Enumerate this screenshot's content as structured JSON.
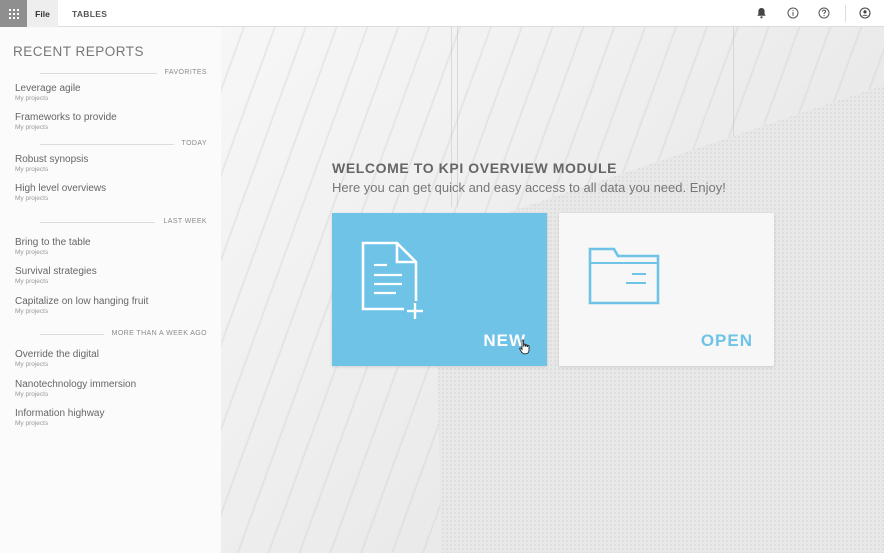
{
  "topbar": {
    "file_tab": "File",
    "tables_tab": "TABLES",
    "icons": [
      "apps-grid-icon",
      "bell-icon",
      "info-icon",
      "help-icon",
      "user-icon"
    ]
  },
  "sidebar": {
    "title": "RECENT REPORTS",
    "sections": [
      {
        "label": "FAVORITES",
        "items": [
          {
            "title": "Leverage agile",
            "subtitle": "My projects"
          },
          {
            "title": "Frameworks to provide",
            "subtitle": "My projects"
          }
        ]
      },
      {
        "label": "TODAY",
        "items": [
          {
            "title": "Robust synopsis",
            "subtitle": "My projects"
          },
          {
            "title": "High level overviews",
            "subtitle": "My projects"
          }
        ]
      },
      {
        "label": "LAST WEEK",
        "items": [
          {
            "title": "Bring to the table",
            "subtitle": "My projects"
          },
          {
            "title": "Survival strategies",
            "subtitle": "My projects"
          },
          {
            "title": "Capitalize on low hanging fruit",
            "subtitle": "My projects"
          }
        ]
      },
      {
        "label": "MORE THAN A WEEK AGO",
        "items": [
          {
            "title": "Override the digital",
            "subtitle": "My projects"
          },
          {
            "title": "Nanotechnology immersion",
            "subtitle": "My projects"
          },
          {
            "title": "Information highway",
            "subtitle": "My projects"
          }
        ]
      }
    ]
  },
  "main": {
    "welcome_title": "WELCOME TO KPI OVERVIEW MODULE",
    "welcome_subtitle": "Here you can get quick and easy access to all data you need. Enjoy!",
    "new_card": {
      "label": "NEW",
      "icon": "new-document-icon",
      "color": "#6ec3e6"
    },
    "open_card": {
      "label": "OPEN",
      "icon": "folder-icon",
      "color": "#6ec3e6"
    }
  }
}
